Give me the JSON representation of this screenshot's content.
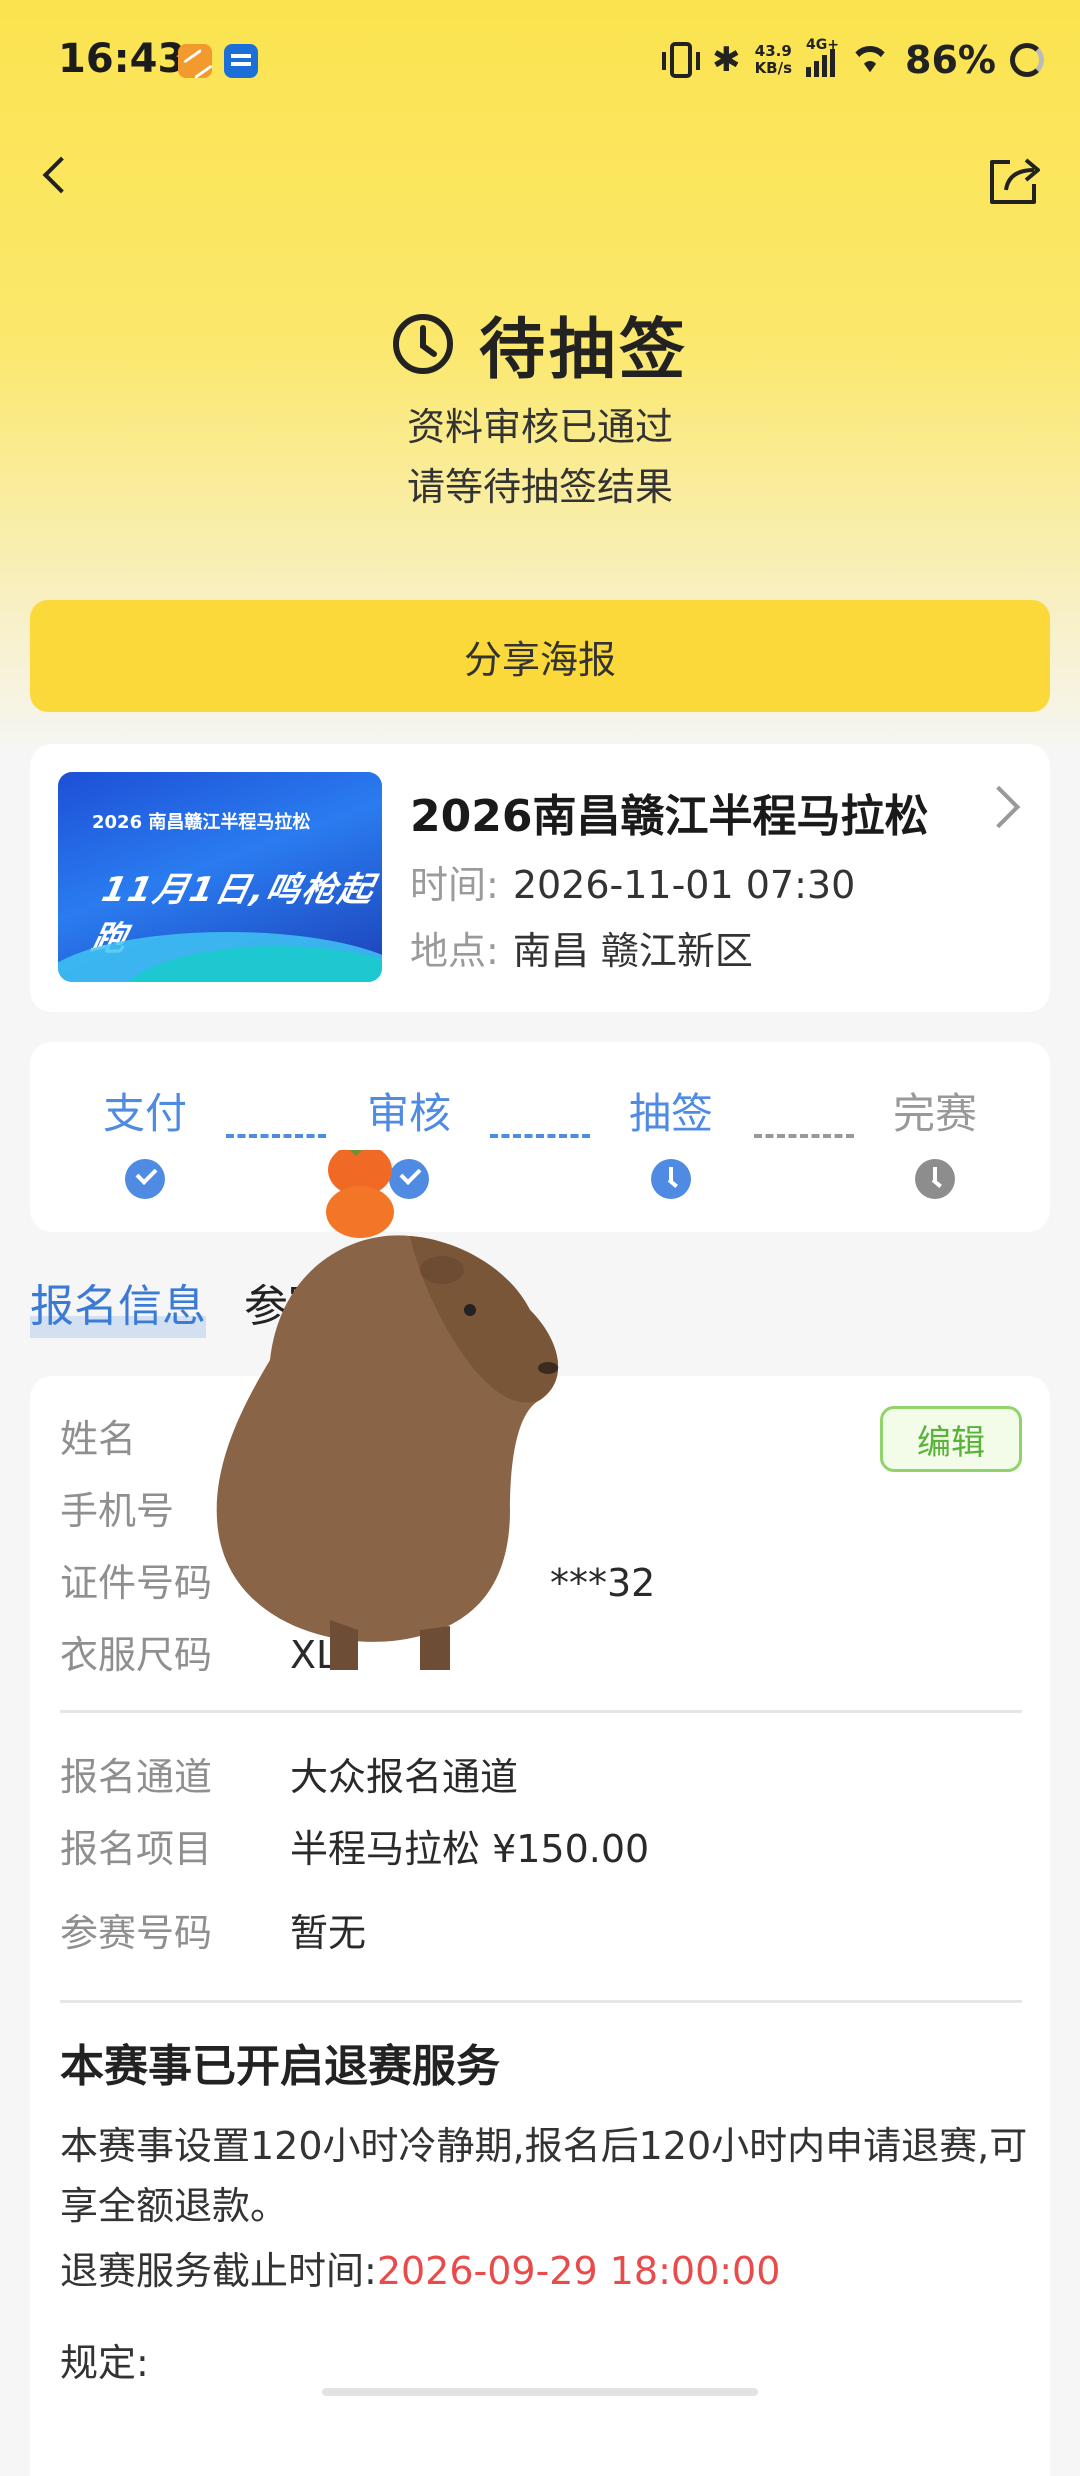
{
  "status_bar": {
    "time": "16:43",
    "speed_top": "43.9",
    "speed_unit": "KB/s",
    "network": "4G+",
    "battery": "86%"
  },
  "header": {
    "back_icon": "chevron-left-icon",
    "share_icon": "share-icon"
  },
  "draw_status": {
    "title": "待抽签",
    "line1": "资料审核已通过",
    "line2": "请等待抽签结果"
  },
  "share_button": "分享海报",
  "event": {
    "name": "2026南昌赣江半程马拉松",
    "time_label": "时间:",
    "time_value": "2026-11-01 07:30",
    "place_label": "地点:",
    "place_value": "南昌 赣江新区",
    "poster_top": "2026 南昌赣江半程马拉松",
    "poster_big": "11月1日,鸣枪起跑"
  },
  "steps": [
    {
      "label": "支付",
      "state": "done"
    },
    {
      "label": "审核",
      "state": "done"
    },
    {
      "label": "抽签",
      "state": "current"
    },
    {
      "label": "完赛",
      "state": "pending"
    }
  ],
  "tabs": {
    "active": "报名信息",
    "inactive": "参赛指"
  },
  "info": {
    "edit": "编辑",
    "name_label": "姓名",
    "name_value": "",
    "phone_label": "手机号",
    "phone_value": "",
    "id_label": "证件号码",
    "id_value": "***32",
    "size_label": "衣服尺码",
    "size_value": "XL",
    "channel_label": "报名通道",
    "channel_value": "大众报名通道",
    "project_label": "报名项目",
    "project_value": "半程马拉松 ¥150.00",
    "bib_label": "参赛号码",
    "bib_value": "暂无"
  },
  "refund": {
    "title": "本赛事已开启退赛服务",
    "text": "本赛事设置120小时冷静期,报名后120小时内申请退赛,可享全额退款。",
    "deadline_label": "退赛服务截止时间:",
    "deadline_value": "2026-09-29 18:00:00",
    "rules_label": "规定:"
  },
  "colors": {
    "accent_blue": "#4f8be2",
    "button_yellow": "#fbd93a",
    "deadline_red": "#e94a4a",
    "edit_green": "#5ab339"
  }
}
